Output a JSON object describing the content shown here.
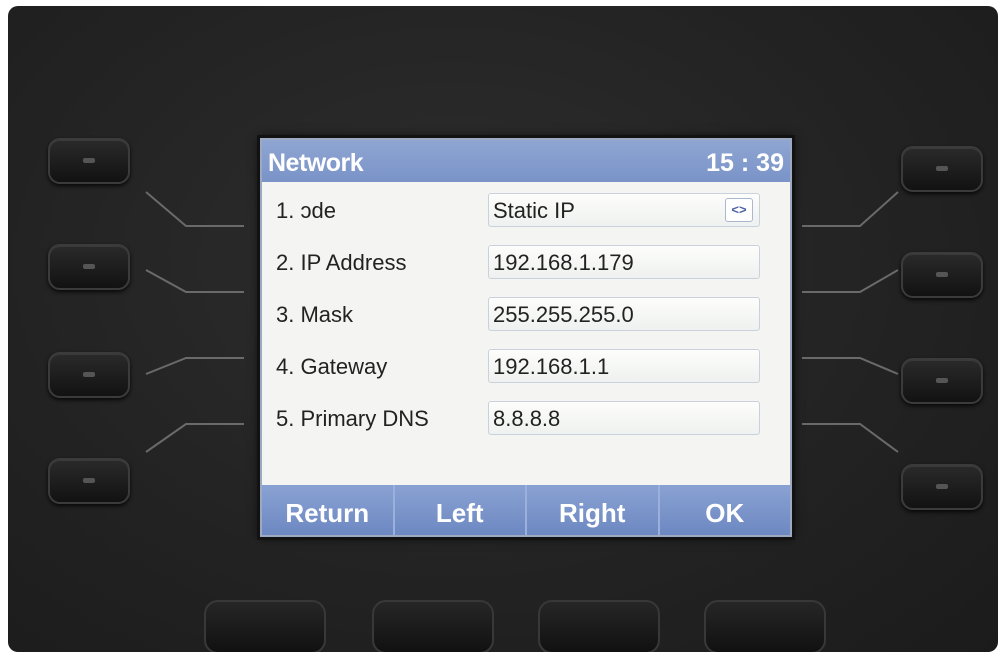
{
  "screen": {
    "title": "Network",
    "time": "15 : 39"
  },
  "rows": [
    {
      "label": "1.  ɔde",
      "value": "Static IP",
      "switch_icon": "<>"
    },
    {
      "label": "2.  IP Address",
      "value": "192.168.1.179"
    },
    {
      "label": "3.  Mask",
      "value": "255.255.255.0"
    },
    {
      "label": "4.  Gateway",
      "value": "192.168.1.1"
    },
    {
      "label": "5.  Primary  DNS",
      "value": "8.8.8.8"
    }
  ],
  "softkeys": [
    "Return",
    "Left",
    "Right",
    "OK"
  ],
  "colors": {
    "title_bar": "#7a93c8",
    "softkey_bar": "#7a93c8",
    "screen_bg": "#f4f4f2",
    "phone_body": "#232323"
  }
}
